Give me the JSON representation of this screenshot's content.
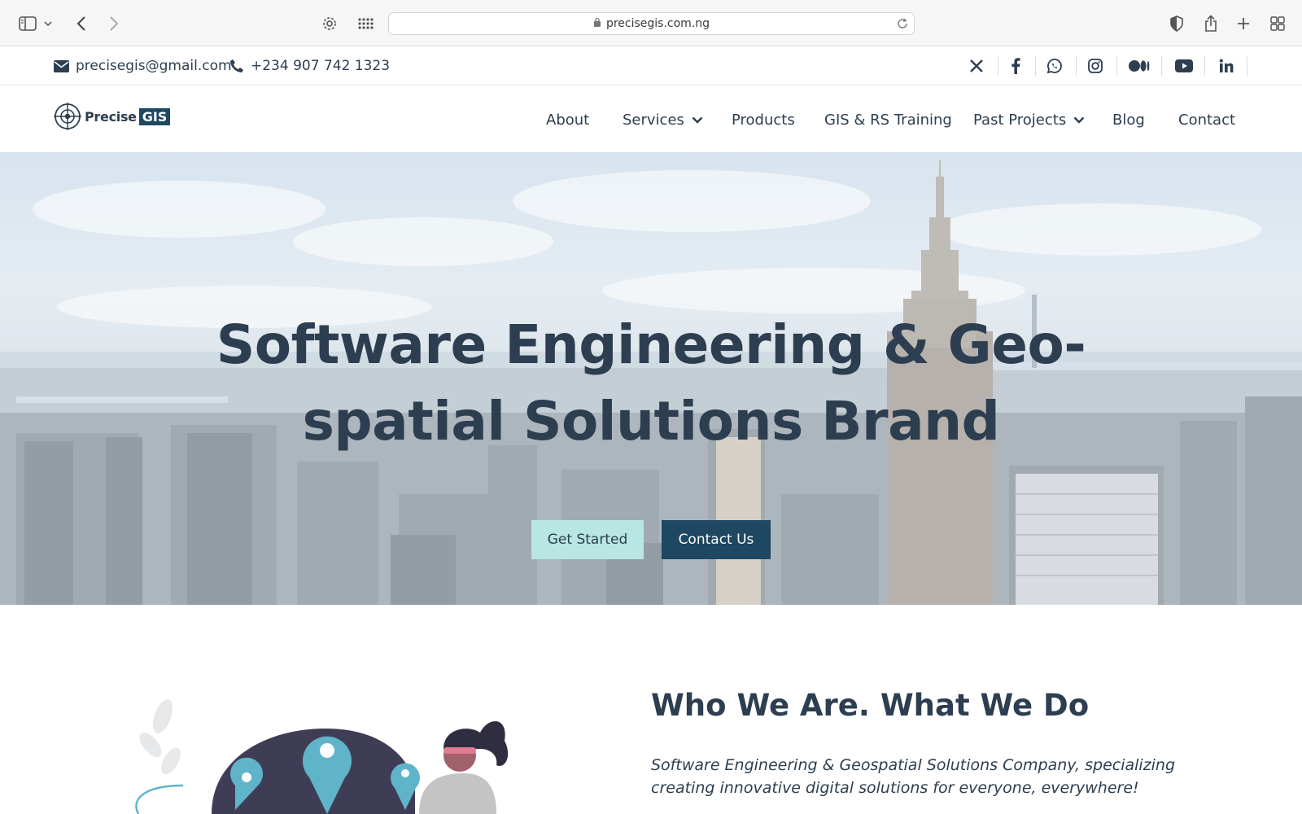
{
  "browser": {
    "url": "precisegis.com.ng"
  },
  "contact_bar": {
    "email": "precisegis@gmail.com",
    "phone": "+234 907 742 1323",
    "socials": [
      "x-icon",
      "facebook-icon",
      "whatsapp-icon",
      "instagram-icon",
      "medium-icon",
      "youtube-icon",
      "linkedin-icon"
    ]
  },
  "logo": {
    "text": "Precise",
    "box": "GIS"
  },
  "nav": {
    "items": [
      {
        "label": "About"
      },
      {
        "label": "Services"
      },
      {
        "label": "Products"
      },
      {
        "label": "GIS & RS Training"
      },
      {
        "label": "Past Projects"
      },
      {
        "label": "Blog"
      },
      {
        "label": "Contact"
      }
    ]
  },
  "hero": {
    "title": "Software Engineering & Geo-spatial Solutions Brand",
    "get_started": "Get Started",
    "contact_us": "Contact Us"
  },
  "about": {
    "title": "Who We Are. What We Do",
    "text": "Software Engineering & Geospatial Solutions Company, specializing creating innovative digital solutions for everyone, everywhere!"
  },
  "colors": {
    "brand_dark": "#1e4761",
    "text": "#2c3e50",
    "accent_light": "#b8e6e2",
    "pin": "#5fb4c9"
  }
}
